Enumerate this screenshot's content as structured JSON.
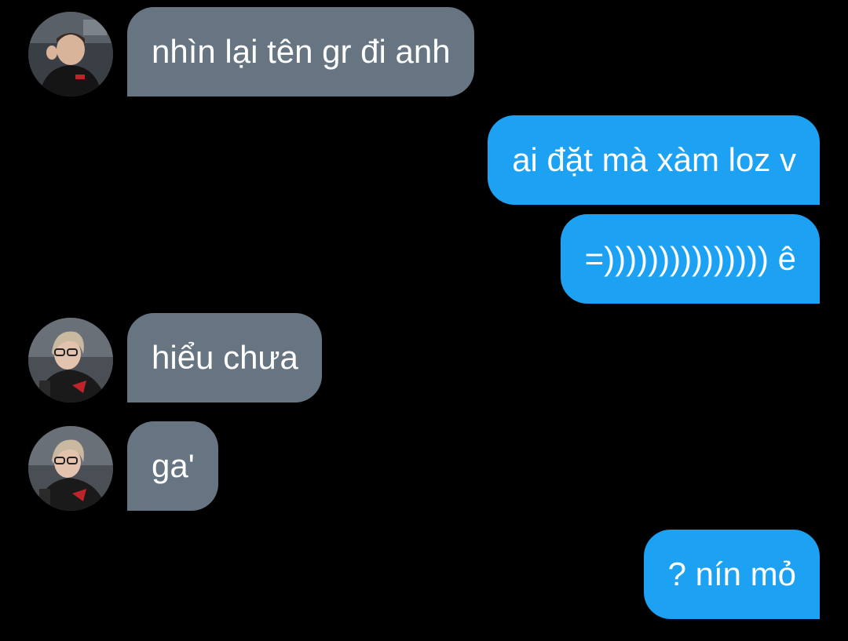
{
  "conversation": {
    "messages": [
      {
        "sender": "other",
        "avatar": "avatar-man-red-jacket",
        "text": "nhìn lại tên gr đi anh"
      },
      {
        "sender": "me",
        "text": "ai đặt mà xàm loz v"
      },
      {
        "sender": "me",
        "text": "=))))))))))))))) ê"
      },
      {
        "sender": "other",
        "avatar": "avatar-man-glasses",
        "text": "hiểu chưa"
      },
      {
        "sender": "other",
        "avatar": "avatar-man-glasses",
        "text": "ga'"
      },
      {
        "sender": "me",
        "text": "? nín mỏ"
      }
    ]
  },
  "colors": {
    "background": "#000000",
    "incoming_bubble": "#677482",
    "outgoing_bubble": "#1da1f2",
    "text": "#ffffff"
  }
}
